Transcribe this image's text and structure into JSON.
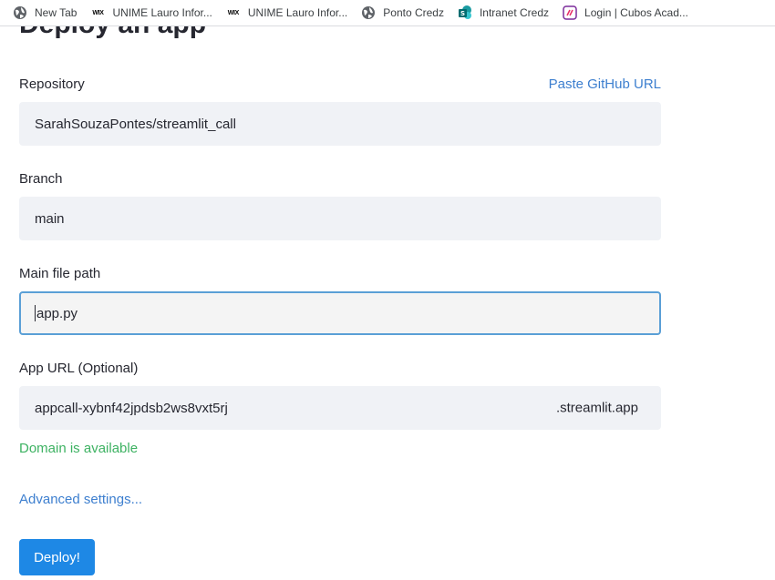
{
  "bookmarks": [
    {
      "label": "New Tab",
      "icon": "globe-icon"
    },
    {
      "label": "UNIME Lauro Infor...",
      "icon": "wix-icon",
      "icon_text": "WIX"
    },
    {
      "label": "UNIME Lauro Infor...",
      "icon": "wix-icon",
      "icon_text": "WIX"
    },
    {
      "label": "Ponto Credz",
      "icon": "globe-icon"
    },
    {
      "label": "Intranet Credz",
      "icon": "sharepoint-icon"
    },
    {
      "label": "Login | Cubos Acad...",
      "icon": "cubos-icon"
    }
  ],
  "page": {
    "title": "Deploy an app"
  },
  "repository": {
    "label": "Repository",
    "paste_link": "Paste GitHub URL",
    "value": "SarahSouzaPontes/streamlit_call"
  },
  "branch": {
    "label": "Branch",
    "value": "main"
  },
  "main_file": {
    "label": "Main file path",
    "value": "app.py"
  },
  "app_url": {
    "label": "App URL (Optional)",
    "value": "appcall-xybnf42jpdsb2ws8vxt5rj",
    "suffix": ".streamlit.app",
    "status": "Domain is available"
  },
  "advanced_link": "Advanced settings...",
  "deploy_button": "Deploy!",
  "colors": {
    "accent": "#1e88e5",
    "link": "#3d7fcf",
    "success": "#3db262",
    "input_bg": "#f0f2f6"
  }
}
